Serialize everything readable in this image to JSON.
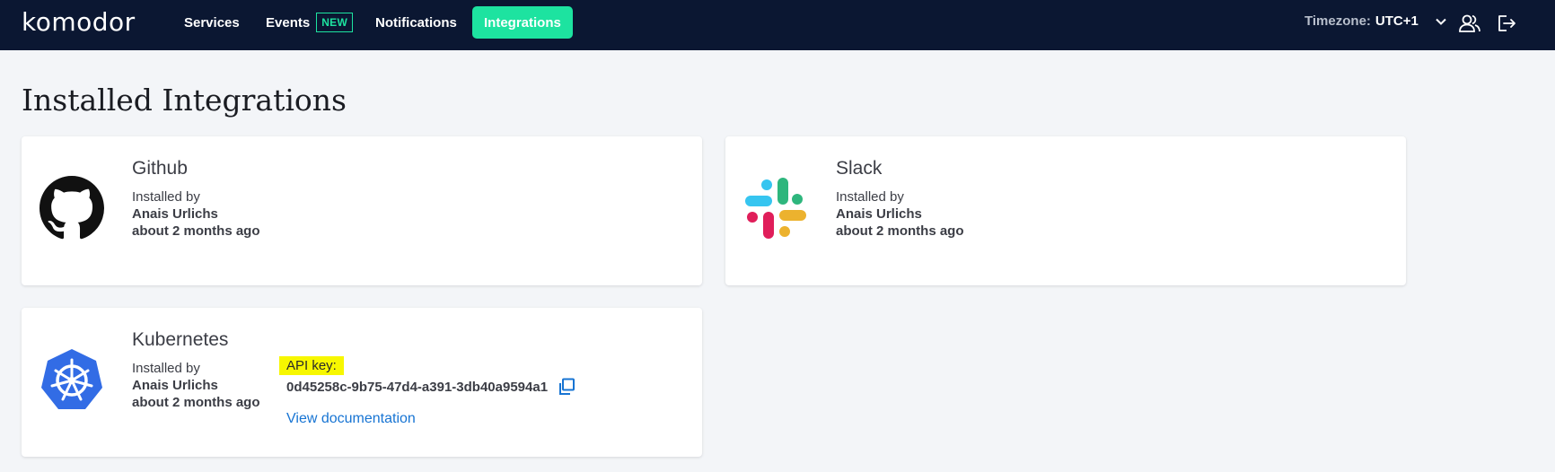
{
  "app": {
    "logo_text": "komodor"
  },
  "nav": {
    "items": [
      {
        "label": "Services"
      },
      {
        "label": "Events",
        "badge": "NEW"
      },
      {
        "label": "Notifications"
      },
      {
        "label": "Integrations",
        "active": true
      }
    ],
    "timezone_label": "Timezone:",
    "timezone_value": "UTC+1"
  },
  "icons": {
    "timezone_dropdown": "chevron-down-icon",
    "users": "users-icon",
    "logout": "logout-icon",
    "copy": "copy-icon"
  },
  "colors": {
    "nav_bg": "#0b1732",
    "accent": "#1de3a0",
    "link": "#1774d3",
    "highlight": "#f7f700",
    "kubernetes": "#326ce5"
  },
  "page": {
    "title": "Installed Integrations"
  },
  "integrations": [
    {
      "name": "Github",
      "installed_label": "Installed by",
      "installed_by": "Anais Urlichs",
      "installed_time": "about 2 months ago",
      "icon": "github-icon"
    },
    {
      "name": "Slack",
      "installed_label": "Installed by",
      "installed_by": "Anais Urlichs",
      "installed_time": "about 2 months ago",
      "icon": "slack-icon"
    },
    {
      "name": "Kubernetes",
      "installed_label": "Installed by",
      "installed_by": "Anais Urlichs",
      "installed_time": "about 2 months ago",
      "icon": "kubernetes-icon",
      "api_key_label": "API key:",
      "api_key": "0d45258c-9b75-47d4-a391-3db40a9594a1",
      "doc_link": "View documentation"
    }
  ]
}
